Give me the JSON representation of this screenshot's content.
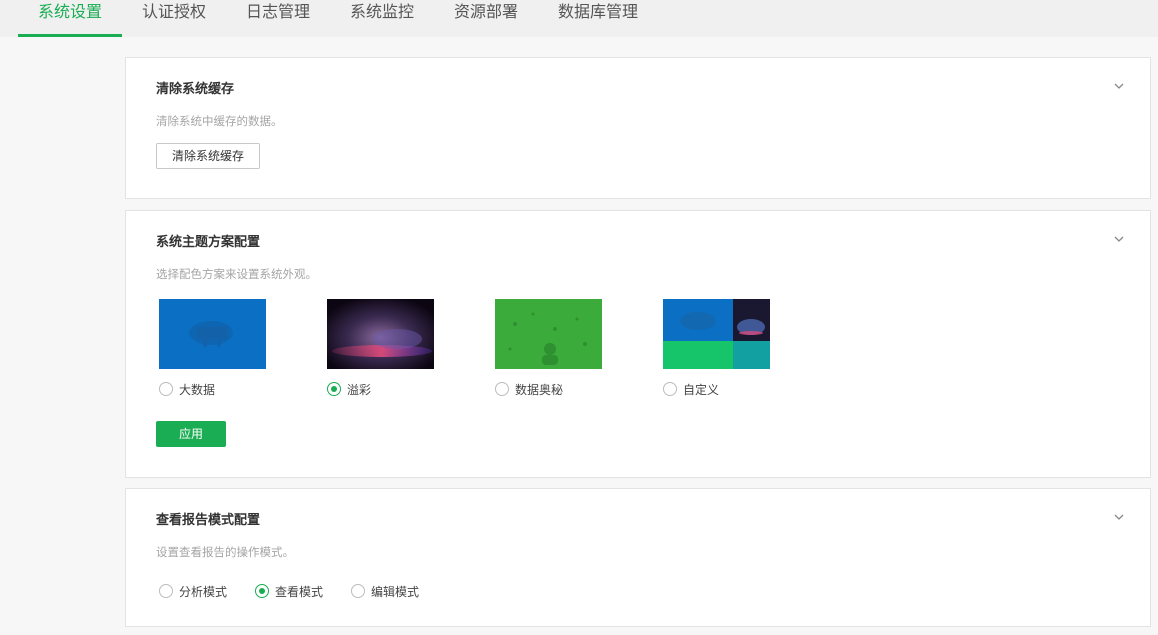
{
  "tabs": [
    {
      "label": "系统设置",
      "active": true
    },
    {
      "label": "认证授权",
      "active": false
    },
    {
      "label": "日志管理",
      "active": false
    },
    {
      "label": "系统监控",
      "active": false
    },
    {
      "label": "资源部署",
      "active": false
    },
    {
      "label": "数据库管理",
      "active": false
    }
  ],
  "accent_color": "#1aad53",
  "cache_panel": {
    "title": "清除系统缓存",
    "description": "清除系统中缓存的数据。",
    "button_label": "清除系统缓存",
    "collapse_icon": "chevron-down-icon"
  },
  "theme_panel": {
    "title": "系统主题方案配置",
    "description": "选择配色方案来设置系统外观。",
    "options": [
      {
        "label": "大数据",
        "selected": false,
        "thumbnail": "blue-bigdata-thumbnail"
      },
      {
        "label": "溢彩",
        "selected": true,
        "thumbnail": "aurora-thumbnail"
      },
      {
        "label": "数据奥秘",
        "selected": false,
        "thumbnail": "green-network-thumbnail"
      },
      {
        "label": "自定义",
        "selected": false,
        "thumbnail": "custom-mosaic-thumbnail"
      }
    ],
    "apply_label": "应用",
    "collapse_icon": "chevron-down-icon"
  },
  "report_panel": {
    "title": "查看报告模式配置",
    "description": "设置查看报告的操作模式。",
    "options": [
      {
        "label": "分析模式",
        "selected": false
      },
      {
        "label": "查看模式",
        "selected": true
      },
      {
        "label": "编辑模式",
        "selected": false
      }
    ],
    "collapse_icon": "chevron-down-icon"
  }
}
